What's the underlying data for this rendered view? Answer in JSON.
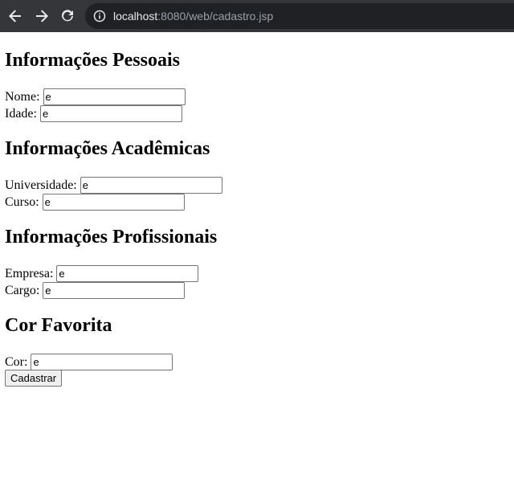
{
  "browser": {
    "url_host": "localhost",
    "url_rest": ":8080/web/cadastro.jsp"
  },
  "sections": {
    "pessoais": {
      "title": "Informações Pessoais",
      "nome_label": "Nome:",
      "nome_value": "e",
      "idade_label": "Idade:",
      "idade_value": "e"
    },
    "academicas": {
      "title": "Informações Acadêmicas",
      "universidade_label": "Universidade:",
      "universidade_value": "e",
      "curso_label": "Curso:",
      "curso_value": "e"
    },
    "profissionais": {
      "title": "Informações Profissionais",
      "empresa_label": "Empresa:",
      "empresa_value": "e",
      "cargo_label": "Cargo:",
      "cargo_value": "e"
    },
    "cor": {
      "title": "Cor Favorita",
      "cor_label": "Cor:",
      "cor_value": "e"
    }
  },
  "submit_label": "Cadastrar"
}
